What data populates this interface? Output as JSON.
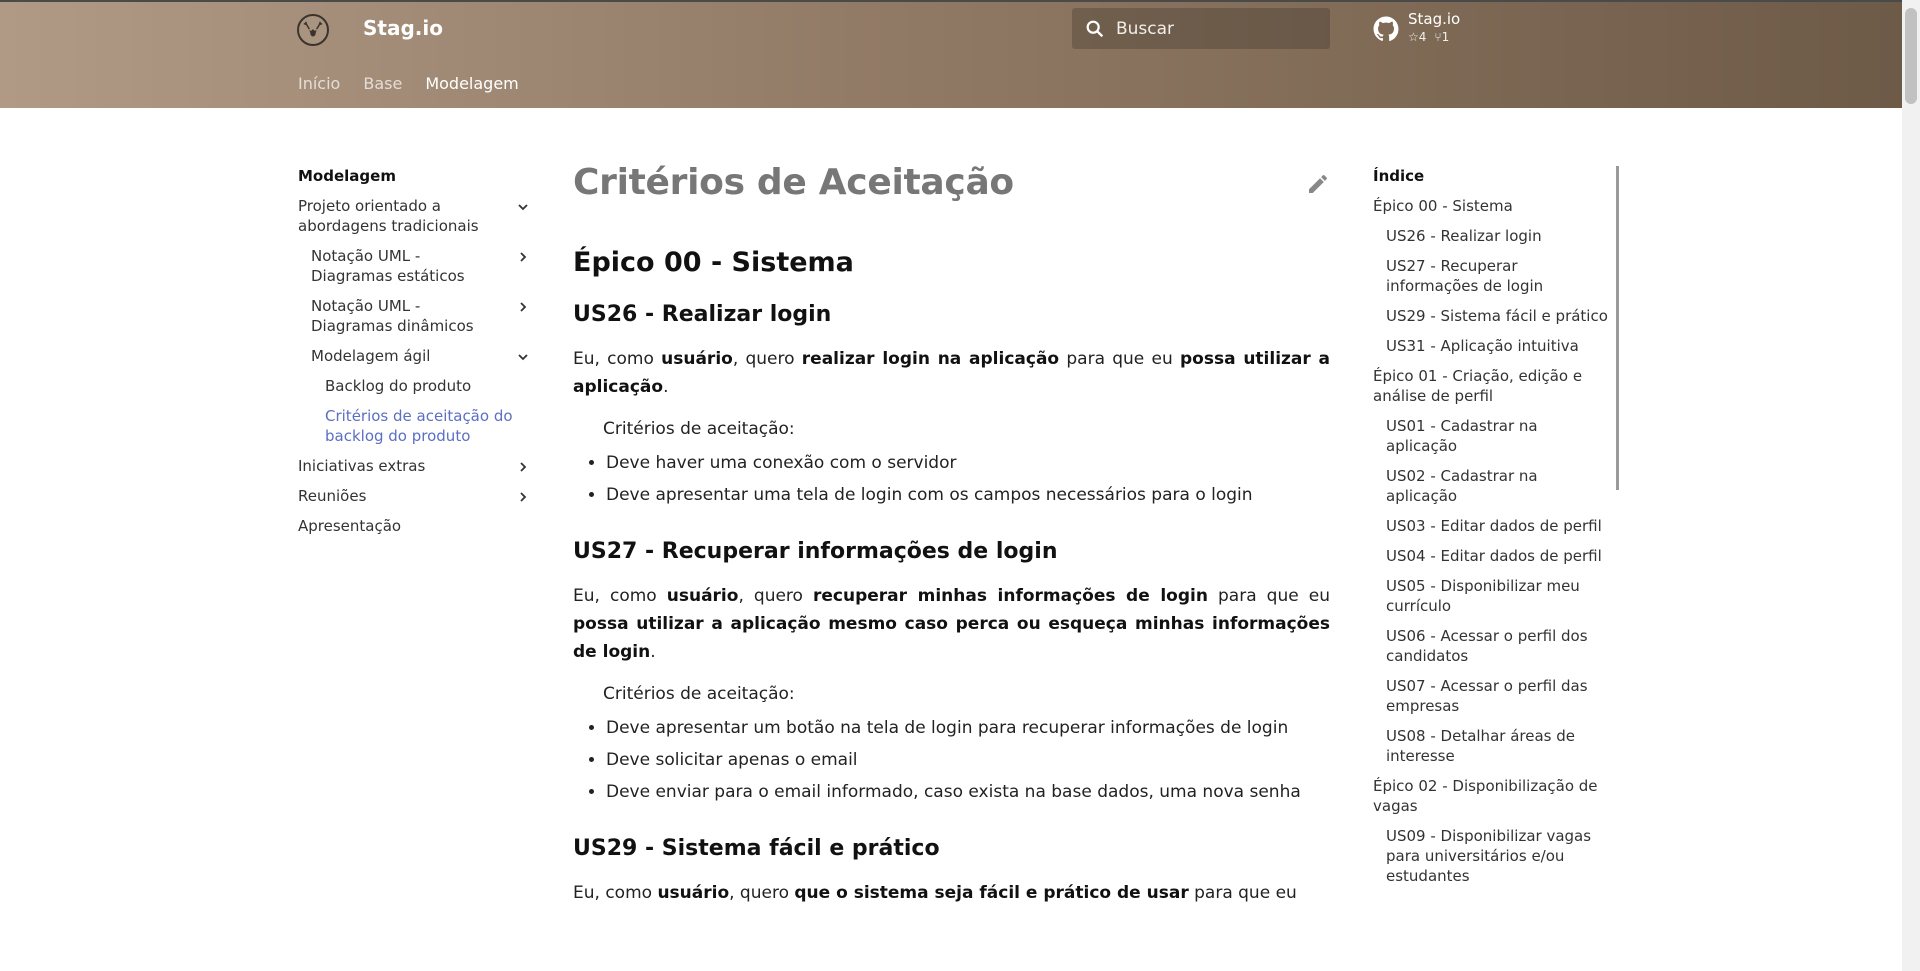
{
  "header": {
    "site_title": "Stag.io",
    "search_placeholder": "Buscar",
    "repo": {
      "name": "Stag.io",
      "stars": "4",
      "forks": "1"
    },
    "tabs": [
      {
        "label": "Início"
      },
      {
        "label": "Base"
      },
      {
        "label": "Modelagem"
      }
    ],
    "active_tab": "Modelagem"
  },
  "sidebar": {
    "title": "Modelagem",
    "items": [
      {
        "label": "Projeto orientado a abordagens tradicionais"
      },
      {
        "label": "Notação UML - Diagramas estáticos"
      },
      {
        "label": "Notação UML - Diagramas dinâmicos"
      },
      {
        "label": "Modelagem ágil"
      },
      {
        "label": "Backlog do produto"
      },
      {
        "label": "Critérios de aceitação do backlog do produto"
      },
      {
        "label": "Iniciativas extras"
      },
      {
        "label": "Reuniões"
      },
      {
        "label": "Apresentação"
      }
    ]
  },
  "main": {
    "title": "Critérios de Aceitação",
    "epic": "Épico 00 - Sistema",
    "criteria_label": "Critérios de aceitação:",
    "us26": {
      "heading": "US26 - Realizar login",
      "p1": "Eu, como ",
      "b1": "usuário",
      "p2": ", quero ",
      "b2": "realizar login na aplicação",
      "p3": " para que eu ",
      "b3": "possa utilizar a aplicação",
      "p4": ".",
      "bullets": [
        "Deve haver uma conexão com o servidor",
        "Deve apresentar uma tela de login com os campos necessários para o login"
      ]
    },
    "us27": {
      "heading": "US27 - Recuperar informações de login",
      "p1": "Eu, como ",
      "b1": "usuário",
      "p2": ", quero ",
      "b2": "recuperar minhas informações de login",
      "p3": " para que eu ",
      "b3": "possa utilizar a aplicação mesmo caso perca ou esqueça minhas informações de login",
      "p4": ".",
      "bullets": [
        "Deve apresentar um botão na tela de login para recuperar informações de login",
        "Deve solicitar apenas o email",
        "Deve enviar para o email informado, caso exista na base dados, uma nova senha"
      ]
    },
    "us29": {
      "heading": "US29 - Sistema fácil e prático",
      "p1": "Eu, como ",
      "b1": "usuário",
      "p2": ", quero ",
      "b2": "que o sistema seja fácil e prático de usar",
      "p3": " para que eu"
    }
  },
  "toc": {
    "title": "Índice",
    "items": [
      "Épico 00 - Sistema",
      "US26 - Realizar login",
      "US27 - Recuperar informações de login",
      "US29 - Sistema fácil e prático",
      "US31 - Aplicação intuitiva",
      "Épico 01 - Criação, edição e análise de perfil",
      "US01 - Cadastrar na aplicação",
      "US02 - Cadastrar na aplicação",
      "US03 - Editar dados de perfil",
      "US04 - Editar dados de perfil",
      "US05 - Disponibilizar meu currículo",
      "US06 - Acessar o perfil dos candidatos",
      "US07 - Acessar o perfil das empresas",
      "US08 - Detalhar áreas de interesse",
      "Épico 02 - Disponibilização de vagas",
      "US09 - Disponibilizar vagas para universitários e/ou estudantes"
    ]
  },
  "colors": {
    "header_start": "#b09a86",
    "header_end": "#6d5a47",
    "active_link": "#5b6fc3"
  }
}
